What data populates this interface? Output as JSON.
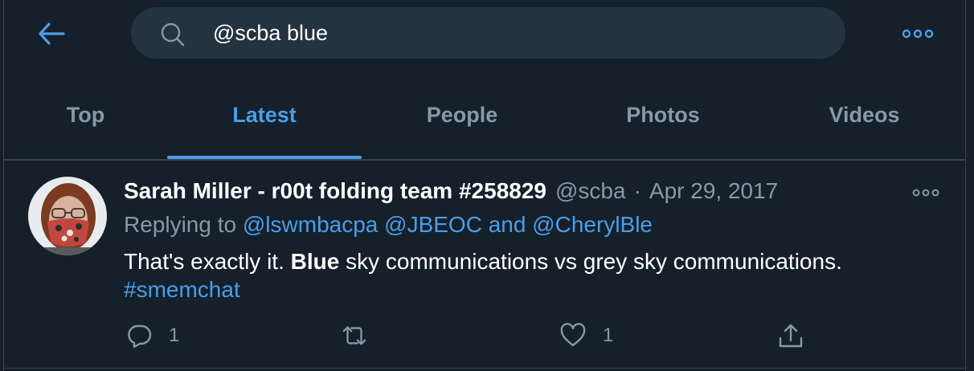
{
  "search": {
    "query": "@scba blue"
  },
  "tabs": [
    {
      "label": "Top",
      "active": false
    },
    {
      "label": "Latest",
      "active": true
    },
    {
      "label": "People",
      "active": false
    },
    {
      "label": "Photos",
      "active": false
    },
    {
      "label": "Videos",
      "active": false
    }
  ],
  "colors": {
    "background": "#15202b",
    "accent": "#4a9ee8",
    "muted_text": "#8899a6",
    "search_bg": "#253341",
    "divider": "#38444d"
  },
  "tweet": {
    "display_name": "Sarah Miller - r00t folding team #258829",
    "handle": "@scba",
    "separator": "·",
    "date": "Apr 29, 2017",
    "replying_prefix": "Replying to",
    "replying_mentions": [
      "@lswmbacpa",
      "@JBEOC"
    ],
    "replying_and": "and",
    "replying_last": "@CherylBle",
    "text_before": "That's exactly it.",
    "text_bold": "Blue",
    "text_after": "sky communications vs grey sky communications.",
    "hashtag": "#smemchat",
    "actions": {
      "reply_count": "1",
      "retweet_count": "",
      "like_count": "1"
    },
    "icons": {
      "reply": "reply-icon",
      "retweet": "retweet-icon",
      "like": "heart-icon",
      "share": "share-icon"
    }
  }
}
